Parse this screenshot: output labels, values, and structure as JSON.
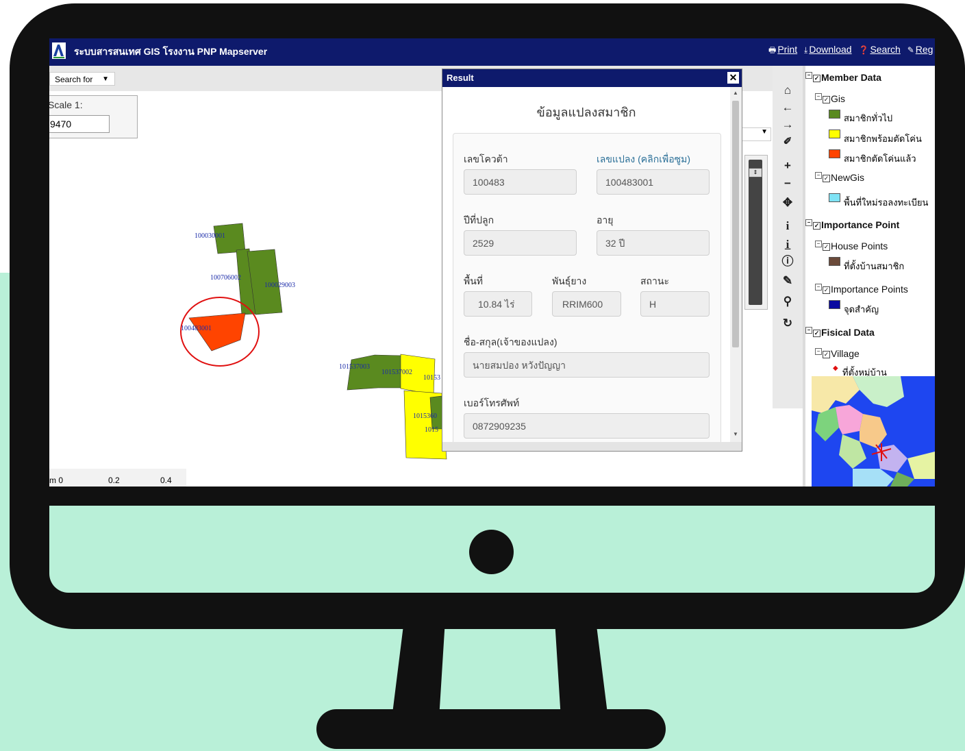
{
  "app": {
    "title": "ระบบสารสนเทศ GIS โรงงาน PNP Mapserver",
    "menu": [
      "Print",
      "Download",
      "Search",
      "Reg"
    ]
  },
  "search": {
    "select_label": "Search for"
  },
  "scale": {
    "label": "Scale 1:",
    "value": "9470"
  },
  "scalebar": {
    "labels": [
      "m 0",
      "0.2",
      "0.4"
    ]
  },
  "map": {
    "plots": [
      "100030001",
      "100706002",
      "100029003",
      "100483001",
      "101537003",
      "101537002",
      "10153",
      "1015360",
      "1015"
    ]
  },
  "result": {
    "window_title": "Result",
    "heading": "ข้อมูลแปลงสมาชิก",
    "fields": {
      "quota_label": "เลขโควต้า",
      "quota_value": "100483",
      "plot_label": "เลขแปลง (คลิกเพื่อซูม)",
      "plot_value": "100483001",
      "year_label": "ปีที่ปลูก",
      "year_value": "2529",
      "age_label": "อายุ",
      "age_value": "32 ปี",
      "area_label": "พื้นที่",
      "area_value": "10.84 ไร่",
      "variety_label": "พันธุ์ยาง",
      "variety_value": "RRIM600",
      "status_label": "สถานะ",
      "status_value": "H",
      "owner_label": "ชื่อ-สกุล(เจ้าของแปลง)",
      "owner_value": "นายสมปอง  หวังปัญญา",
      "phone_label": "เบอร์โทรศัพท์",
      "phone_value": "0872909235"
    }
  },
  "legend": {
    "member_data": "Member Data",
    "gis": "Gis",
    "gis_items": [
      {
        "label": "สมาชิกทั่วไป",
        "color": "#5a8a1f"
      },
      {
        "label": "สมาชิกพร้อมตัดโค่น",
        "color": "#ffff00"
      },
      {
        "label": "สมาชิกตัดโค่นแล้ว",
        "color": "#ff4400"
      }
    ],
    "newgis": "NewGis",
    "newgis_item": {
      "label": "พื้นที่ใหม่รอลงทะเบียน",
      "color": "#7fe3f5"
    },
    "importance_point": "Importance Point",
    "house_points": "House Points",
    "house_item": {
      "label": "ที่ตั้งบ้านสมาชิก",
      "color": "#6b4a3a"
    },
    "importance_points": "Importance Points",
    "importance_item": {
      "label": "จุดสำคัญ",
      "color": "#0a0aa0"
    },
    "fisical_data": "Fisical Data",
    "village": "Village",
    "village_item": "ที่ตั้งหมู่บ้าน"
  },
  "tools": [
    "home-icon",
    "back-arrow-icon",
    "forward-arrow-icon",
    "measure-icon",
    "zoom-in-icon",
    "zoom-out-icon",
    "pan-icon",
    "info-icon",
    "identify-icon",
    "query-info-icon",
    "ruler-icon",
    "pin-icon",
    "refresh-icon"
  ]
}
